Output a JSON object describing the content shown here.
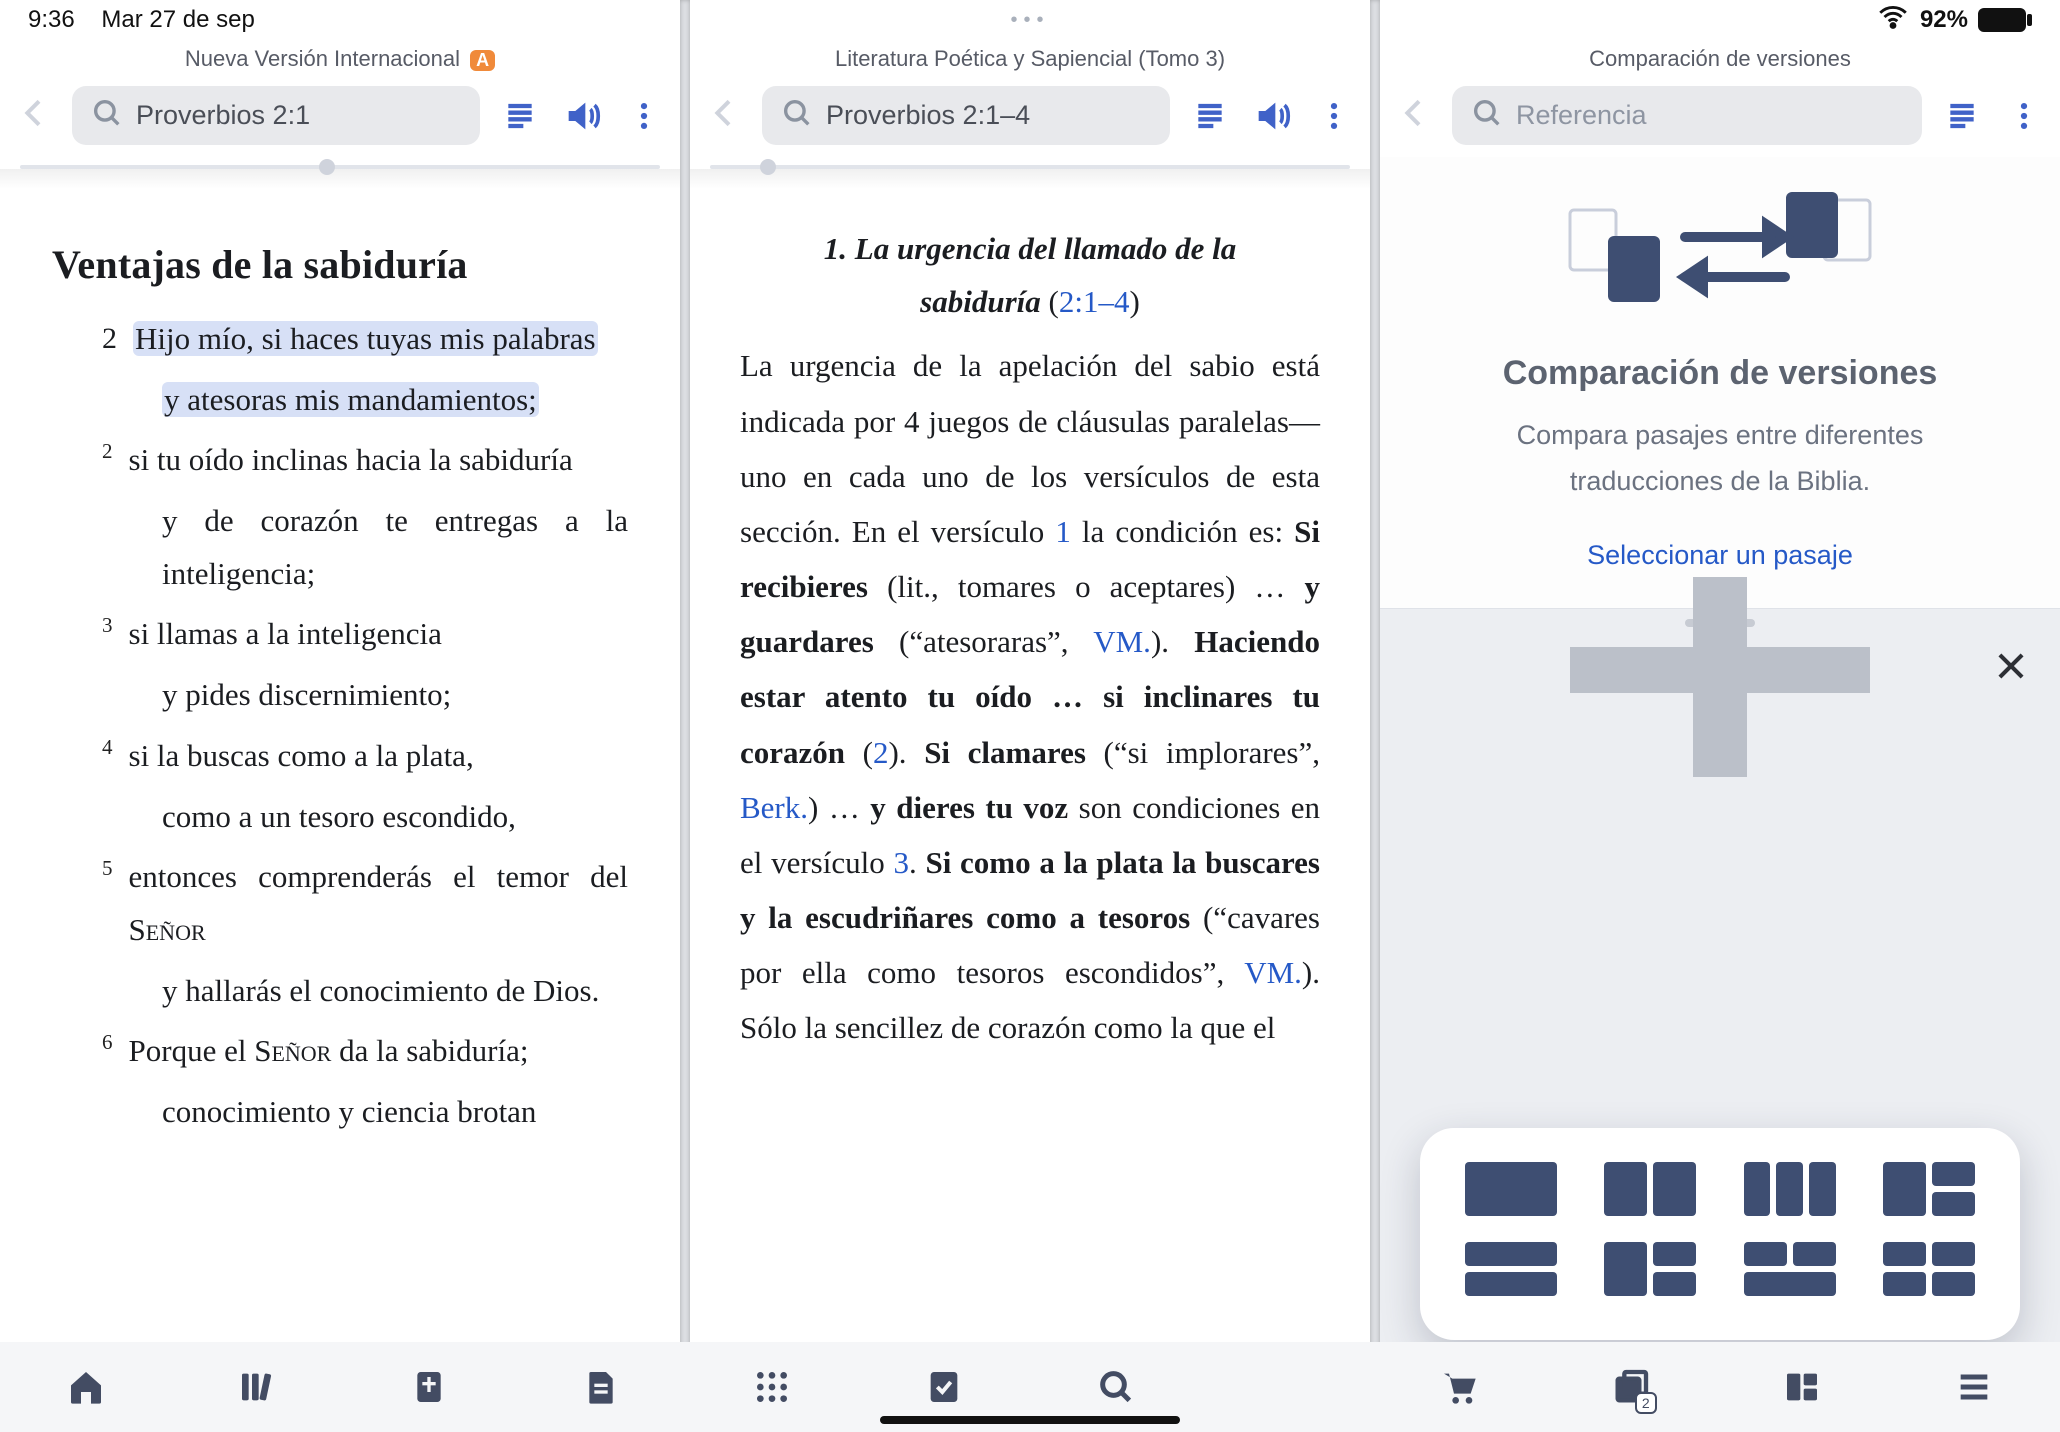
{
  "statusbar": {
    "time": "9:36",
    "date": "Mar 27 de sep",
    "wifi": true,
    "battery_text": "92%"
  },
  "pane1": {
    "header_title": "Nueva Versión Internacional",
    "badge": "A",
    "search_ref": "Proverbios 2:1",
    "slider_pos_pct": 48,
    "section_title": "Ventajas de la sabiduría",
    "v2_a": "Hijo mío, si haces tuyas mis palabras",
    "v2_b": "y atesoras mis mandamientos;",
    "v2s_a": "si tu oído inclinas hacia la sabiduría",
    "v2s_b": "y de corazón te entregas a la inteligencia;",
    "v3_a": "si llamas a la inteligencia",
    "v3_b": "y pides discernimiento;",
    "v4_a": "si la buscas como a la plata,",
    "v4_b": "como a un tesoro escondido,",
    "v5_a": "entonces comprenderás el temor del ",
    "v5_lord": "Señor",
    "v5_b": "y hallarás el conocimiento de Dios.",
    "v6_a": "Porque el ",
    "v6_lord": "Señor",
    "v6_b": " da la sabiduría;",
    "v6_c": "conocimiento y ciencia brotan"
  },
  "pane2": {
    "header_title": "Literatura Poética y Sapiencial (Tomo 3)",
    "search_ref": "Proverbios 2:1–4",
    "slider_pos_pct": 9,
    "para_num": "1.",
    "para_title_a": "La urgencia del llamado de la sabiduría",
    "para_ref": "2:1–4",
    "body_1": "La urgencia de la apelación del sabio está indicada por 4 juegos de cláusulas paralelas—uno en cada uno de los versículos de esta sección. En el versículo ",
    "link_1": "1",
    "body_2": " la condición es: ",
    "b_si_recibieres": "Si recibieres",
    "body_3": " (lit., tomares o aceptares) … ",
    "b_y_guardares": "y guardares",
    "body_4": " (“atesoraras”, ",
    "link_vm1": "VM.",
    "body_5": "). ",
    "b_haciendo": "Haciendo estar atento tu oído … si inclinares tu corazón",
    "body_6": " (",
    "link_2": "2",
    "body_7": "). ",
    "b_si_clamares": "Si clamares",
    "body_8": " (“si implorares”, ",
    "link_berk": "Berk.",
    "body_9": ") … ",
    "b_y_dieres": "y dieres tu voz",
    "body_10": " son condiciones en el versículo ",
    "link_3": "3",
    "body_11": ". ",
    "b_si_como": "Si como a la plata la buscares y la escudriñares como a tesoros",
    "body_12": " (“cavares por ella como tesoros escondidos”, ",
    "link_vm2": "VM.",
    "body_13": "). Sólo la sencillez de corazón como la que el"
  },
  "pane3": {
    "header_title": "Comparación de versiones",
    "search_placeholder": "Referencia",
    "card_title": "Comparación de versiones",
    "card_sub": "Compara pasajes entre diferentes traducciones de la Biblia.",
    "card_cta": "Seleccionar un pasaje"
  },
  "bottombar": {
    "home": "home-icon",
    "library": "library-icon",
    "bible": "bible-icon",
    "doc": "document-icon",
    "apps": "apps-grid-icon",
    "note": "note-check-icon",
    "search": "search-icon",
    "store": "store-cart-icon",
    "windows": "windows-icon",
    "windows_badge": "2",
    "layout": "layout-icon",
    "menu": "menu-icon"
  }
}
